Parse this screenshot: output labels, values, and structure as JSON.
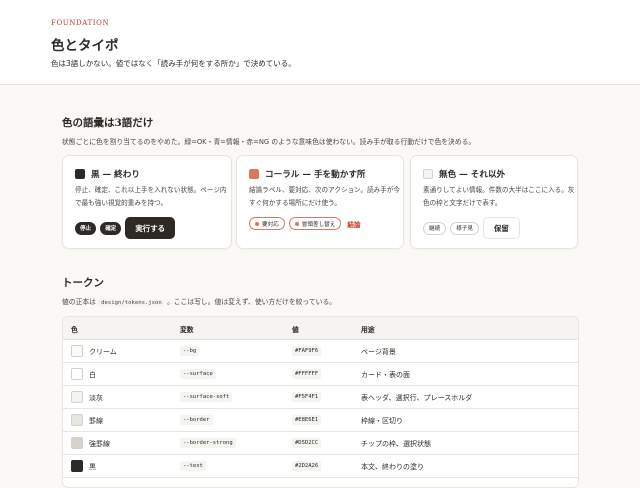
{
  "header": {
    "eyebrow": "FOUNDATION",
    "title": "色とタイポ",
    "description": "色は3語しかない。値ではなく「読み手が何をする所か」で決めている。"
  },
  "vocab": {
    "title": "色の語彙は3語だけ",
    "description": "状態ごとに色を割り当てるのをやめた。緑=OK・青=情報・赤=NG のような意味色は使わない。読み手が取る行動だけで色を決める。",
    "cards": [
      {
        "title": "黒 — 終わり",
        "swatch_color": "#2D2A26",
        "description": "停止、確定、これ以上手を入れない状態。ページ内で最も強い視覚的重みを持つ。",
        "chips": [
          "停止",
          "確定"
        ],
        "button": "実行する"
      },
      {
        "title": "コーラル — 手を動かす所",
        "swatch_color": "#D9785F",
        "description": "結論ラベル、要対応、次のアクション。読み手が今すぐ何かする場所にだけ使う。",
        "chips": [
          "要対応",
          "冒頭差し替え"
        ],
        "link": "結論"
      },
      {
        "title": "無色 — それ以外",
        "swatch_color": "#F5F4F1",
        "description": "素通りしてよい情報。件数の大半はここに入る。灰色の枠と文字だけで表す。",
        "chips": [
          "継続",
          "様子見"
        ],
        "button": "保留"
      }
    ]
  },
  "tokens": {
    "title": "トークン",
    "description_before": "値の正本は",
    "description_code": "design/tokens.json",
    "description_after": "。ここは写し。値は変えず、使い方だけを絞っている。",
    "columns": [
      "色",
      "変数",
      "値",
      "用途"
    ],
    "rows": [
      {
        "name": "クリーム",
        "token": "--bg",
        "hex": "#FAF9F6",
        "use": "ページ背景"
      },
      {
        "name": "白",
        "token": "--surface",
        "hex": "#FFFFFF",
        "use": "カード・表の面"
      },
      {
        "name": "淡灰",
        "token": "--surface-soft",
        "hex": "#F5F4F1",
        "use": "表ヘッダ、選択行、プレースホルダ"
      },
      {
        "name": "罫線",
        "token": "--border",
        "hex": "#E8E6E1",
        "use": "枠線・区切り"
      },
      {
        "name": "強罫線",
        "token": "--border-strong",
        "hex": "#D5D2CC",
        "use": "チップの枠、選択状態"
      },
      {
        "name": "黒",
        "token": "--text",
        "hex": "#2D2A26",
        "use": "本文、終わりの塗り"
      }
    ]
  }
}
